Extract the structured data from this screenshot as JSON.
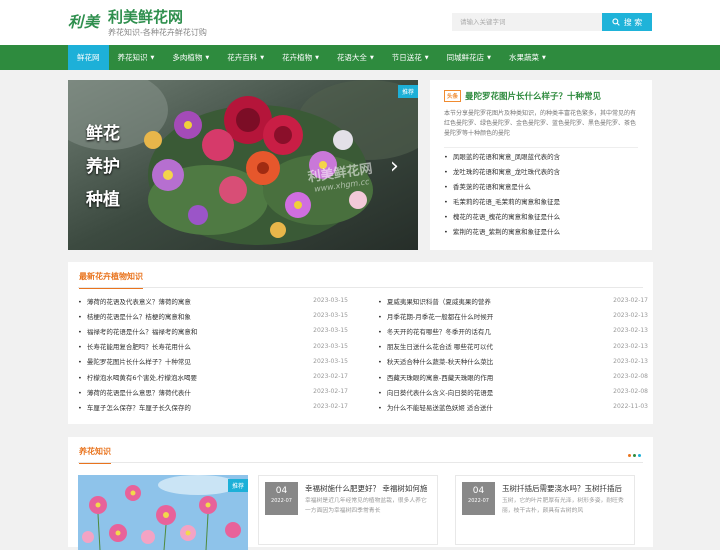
{
  "site": {
    "logo_mark": "利美",
    "title": "利美鲜花网",
    "subtitle": "养花知识-各种花卉鲜花订购"
  },
  "search": {
    "placeholder": "请输入关键字词",
    "button_label": "搜 索"
  },
  "nav": {
    "items": [
      {
        "label": "鲜花网",
        "active": true
      },
      {
        "label": "养花知识"
      },
      {
        "label": "多肉植物"
      },
      {
        "label": "花卉百科"
      },
      {
        "label": "花卉植物"
      },
      {
        "label": "花语大全"
      },
      {
        "label": "节日送花"
      },
      {
        "label": "同城鲜花店"
      },
      {
        "label": "水果蔬菜"
      }
    ]
  },
  "slider": {
    "tag": "推荐",
    "overlay_text": [
      "鲜花",
      "养护",
      "种植"
    ],
    "watermark": "利美鲜花网",
    "watermark_url": "www.xhgm.cc"
  },
  "feature": {
    "badge": "头条",
    "title": "曼陀罗花图片长什么样子？十种常见",
    "summary": "本节分享曼陀罗花图片及种类知识，的种类丰富花色繁多，其中常见的有红色曼陀罗、绿色曼陀罗、金色曼陀罗、蓝色曼陀罗、黑色曼陀罗、茶色曼陀罗等十种颜色的曼陀",
    "links": [
      "凤眼蓝的花语和寓意_凤眼蓝代表的含",
      "龙吐珠的花语和寓意_龙吐珠代表的含",
      "香荚蒾的花语和寓意是什么",
      "毛茉莉的花语_毛茉莉的寓意和象征是",
      "槐花的花语_槐花的寓意和象征是什么",
      "紫荆的花语_紫荆的寓意和象征是什么"
    ]
  },
  "latest": {
    "title": "最新花卉植物知识",
    "left": [
      {
        "t": "薄荷的花语及代表意义？薄荷的寓意",
        "d": "2023-03-15"
      },
      {
        "t": "桔梗的花语是什么？桔梗的寓意和象",
        "d": "2023-03-15"
      },
      {
        "t": "福禄考的花语是什么？福禄考的寓意和",
        "d": "2023-03-15"
      },
      {
        "t": "长寿花能用复合肥吗？长寿花用什么",
        "d": "2023-03-15"
      },
      {
        "t": "曼陀罗花图片长什么样子？十种常见",
        "d": "2023-03-15"
      },
      {
        "t": "柠檬泡水喝黄有6个害处,柠檬泡水喝要",
        "d": "2023-02-17"
      },
      {
        "t": "薄荷的花语是什么意思？薄荷代表什",
        "d": "2023-02-17"
      },
      {
        "t": "车厘子怎么保存？车厘子长久保存的",
        "d": "2023-02-17"
      }
    ],
    "right": [
      {
        "t": "夏威夷果知识科普（夏威夷果的营养",
        "d": "2023-02-17"
      },
      {
        "t": "月季花期-月季花一般都在什么时候开",
        "d": "2023-02-13"
      },
      {
        "t": "冬天开的花有哪些？冬季开的话有几",
        "d": "2023-02-13"
      },
      {
        "t": "朋友生日送什么花合适 哪些花可以代",
        "d": "2023-02-13"
      },
      {
        "t": "秋天适合种什么蔬菜-秋天种什么菜比",
        "d": "2023-02-13"
      },
      {
        "t": "西藏天珠眼的寓意-西藏天珠眼的作用",
        "d": "2023-02-08"
      },
      {
        "t": "向日葵代表什么含义-向日葵的花语是",
        "d": "2023-02-08"
      },
      {
        "t": "为什么不能轻易送蓝色妖姬 适合送什",
        "d": "2022-11-03"
      }
    ]
  },
  "care": {
    "title": "养花知识",
    "photo_tag": "推荐",
    "articles": [
      {
        "day": "04",
        "ym": "2022-07",
        "title": "幸福树施什么肥更好？ 幸福树如何施",
        "desc": "幸福树是近几年经常见的植物盆栽，很多人养它一方面因为幸福树四季常青长"
      },
      {
        "day": "04",
        "ym": "2022-07",
        "title": "玉树扦插后需要浇水吗？玉树扦插后",
        "desc": "玉树，它的叶片肥厚有光泽，树形多姿，耐旺秀丽，枝干古朴，颜具有古树的风"
      }
    ]
  },
  "colors": {
    "brand_green": "#2e8b3e",
    "accent_blue": "#1db0d8",
    "accent_orange": "#e9741e"
  }
}
